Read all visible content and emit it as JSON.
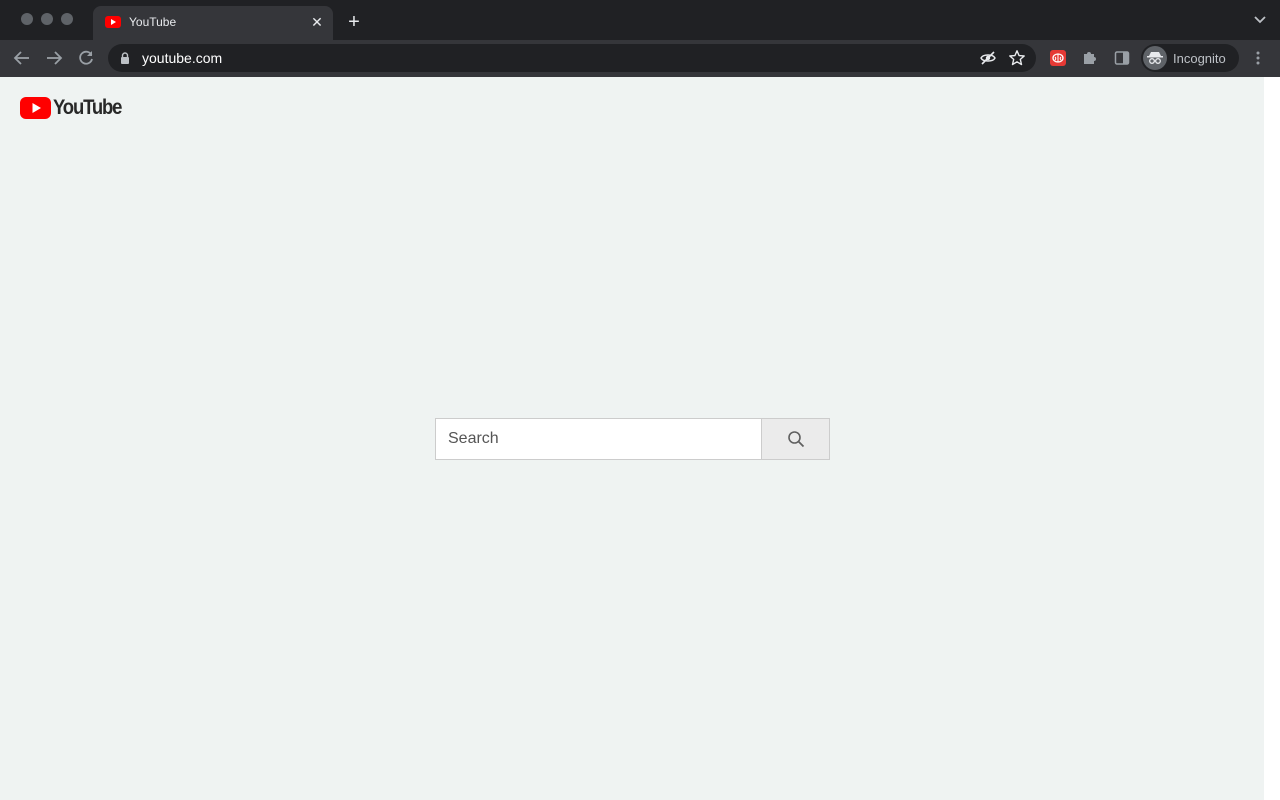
{
  "browser": {
    "tab": {
      "title": "YouTube",
      "close_glyph": "✕",
      "favicon": "youtube-play-icon"
    },
    "new_tab_glyph": "+",
    "url": "youtube.com",
    "profile_label": "Incognito"
  },
  "page": {
    "logo_text": "YouTube",
    "search": {
      "placeholder": "Search",
      "value": ""
    }
  },
  "colors": {
    "brand_red": "#ff0000",
    "page_bg": "#eff3f2",
    "chrome_dark": "#202124",
    "chrome_toolbar": "#35363a"
  }
}
